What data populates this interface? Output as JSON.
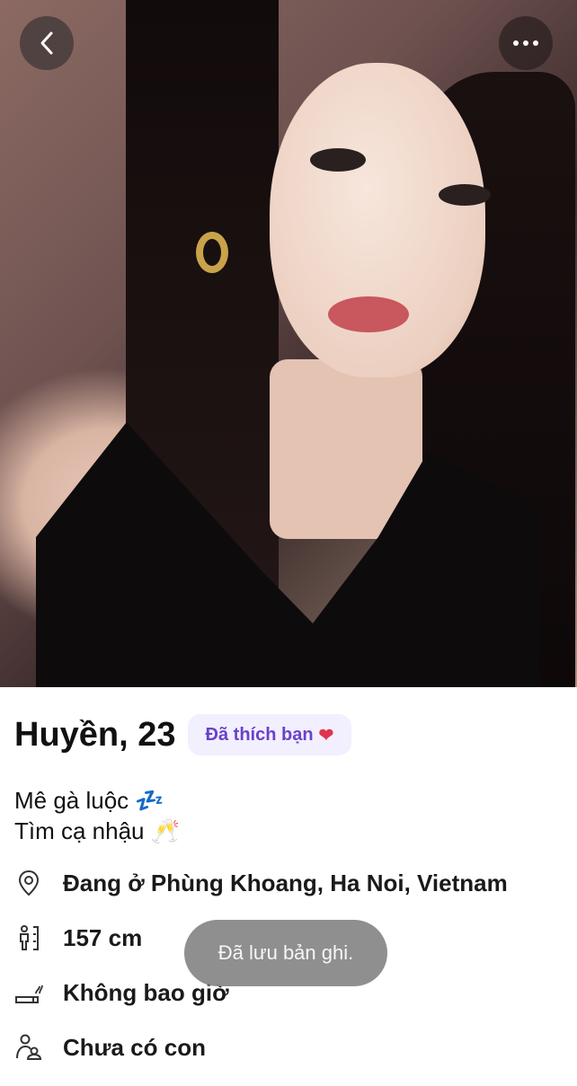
{
  "profile": {
    "name_age": "Huyền, 23",
    "liked_badge": "Đã thích bạn",
    "bio_line1": "Mê gà luộc 💤",
    "bio_line2": "Tìm cạ nhậu 🥂"
  },
  "details": {
    "location": "Đang ở Phùng Khoang, Ha Noi, Vietnam",
    "height": "157 cm",
    "smoking": "Không bao giờ",
    "children": "Chưa có con"
  },
  "toast": {
    "message": "Đã lưu bản ghi."
  },
  "colors": {
    "badge_bg": "#f2efff",
    "badge_text": "#6a41c9",
    "toast_bg": "#8a8a8a"
  }
}
